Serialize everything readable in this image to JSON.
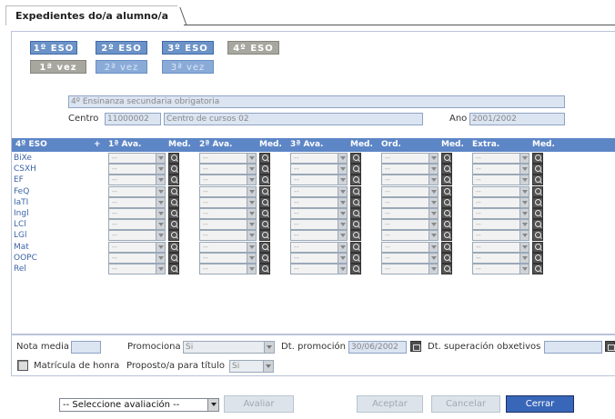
{
  "tab": {
    "title": "Expedientes do/a alumno/a"
  },
  "years": [
    "1º ESO",
    "2º ESO",
    "3º ESO",
    "4º ESO"
  ],
  "attempts": [
    "1ª vez",
    "2ª vez",
    "3ª vez"
  ],
  "info": {
    "course_name": "4º Ensinanza secundaria obrigatoria",
    "centro_label": "Centro",
    "centro_code": "11000002",
    "centro_name": "Centro de cursos 02",
    "ano_label": "Ano",
    "ano_value": "2001/2002"
  },
  "grid": {
    "headers": {
      "course": "4º ESO",
      "plus": "+",
      "ava1": "1ª Ava.",
      "med1": "Med.",
      "ava2": "2ª Ava.",
      "med2": "Med.",
      "ava3": "3ª Ava.",
      "med3": "Med.",
      "ord": "Ord.",
      "med4": "Med.",
      "extra": "Extra.",
      "med5": "Med."
    },
    "subjects": [
      "BiXe",
      "CSXH",
      "EF",
      "FeQ",
      "IaTI",
      "Ingl",
      "LCl",
      "LGl",
      "Mat",
      "OOPC",
      "Rel"
    ],
    "empty_value": "--"
  },
  "bottom": {
    "nota_media_label": "Nota media",
    "nota_media_value": "",
    "promociona_label": "Promociona",
    "promociona_value": "Si",
    "dt_promocion_label": "Dt. promoción",
    "dt_promocion_value": "30/06/2002",
    "dt_superacion_label": "Dt. superación obxetivos",
    "dt_superacion_value": "",
    "matricula_label": "Matrícula de honra",
    "proposto_label": "Proposto/a para título",
    "proposto_value": "Si"
  },
  "actions": {
    "evaluation_select": "-- Seleccione avaliación --",
    "avaliar": "Avaliar",
    "aceptar": "Aceptar",
    "cancelar": "Cancelar",
    "cerrar": "Cerrar"
  }
}
